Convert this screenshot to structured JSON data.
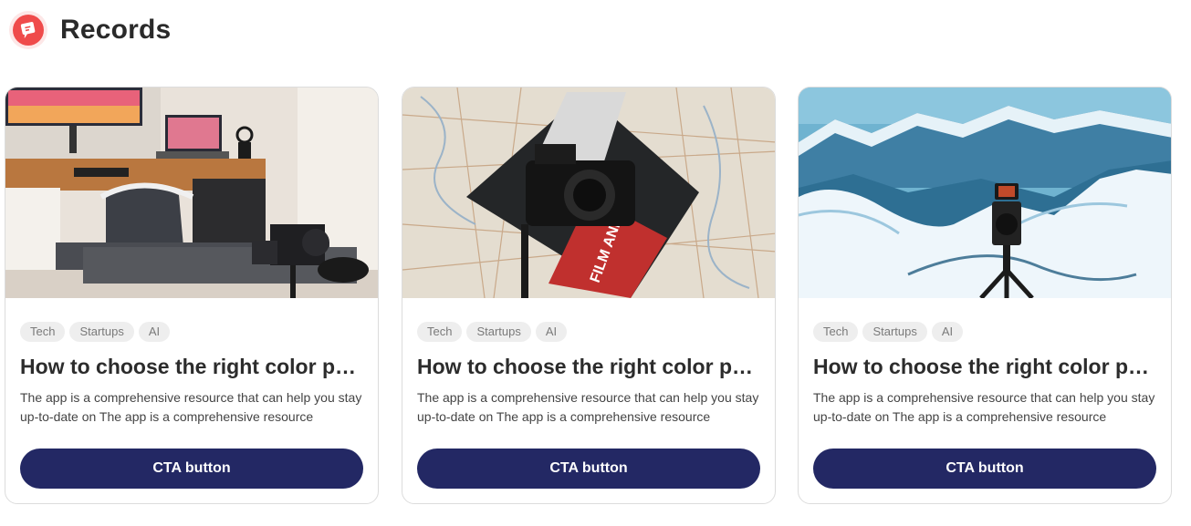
{
  "header": {
    "title": "Records",
    "logo_icon": "chat-bubble-icon"
  },
  "cards": [
    {
      "image": "desk-setup-photo",
      "tags": [
        "Tech",
        "Startups",
        "AI"
      ],
      "title": "How to choose the right color palette for your brand",
      "description": "The app is a comprehensive resource that can help you stay up-to-date on The app is a comprehensive resource",
      "cta": "CTA button"
    },
    {
      "image": "camera-on-map-photo",
      "tags": [
        "Tech",
        "Startups",
        "AI"
      ],
      "title": "How to choose the right color palette for your brand",
      "description": "The app is a comprehensive resource that can help you stay up-to-date on The app is a comprehensive resource",
      "cta": "CTA button"
    },
    {
      "image": "mountain-camera-photo",
      "tags": [
        "Tech",
        "Startups",
        "AI"
      ],
      "title": "How to choose the right color palette for your brand",
      "description": "The app is a comprehensive resource that can help you stay up-to-date on The app is a comprehensive resource",
      "cta": "CTA button"
    }
  ],
  "colors": {
    "accent": "#232864",
    "logo": "#ef4b4b"
  }
}
